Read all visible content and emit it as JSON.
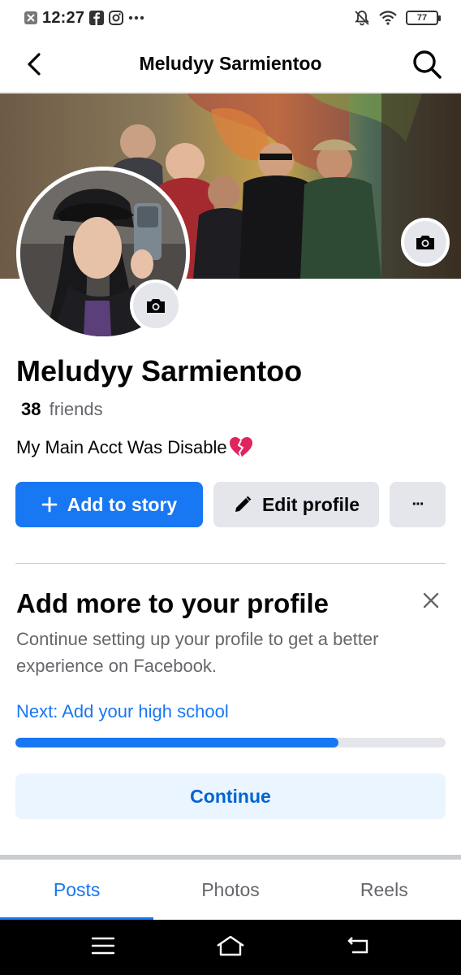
{
  "status_bar": {
    "time": "12:27",
    "battery": "77",
    "left_icons": [
      "app-icon",
      "facebook-icon",
      "instagram-icon",
      "more-dots-icon"
    ],
    "right_icons": [
      "bell-muted-icon",
      "wifi-icon",
      "battery-icon"
    ]
  },
  "header": {
    "title": "Meludyy Sarmientoo",
    "back_icon": "chevron-left-icon",
    "search_icon": "search-icon"
  },
  "profile": {
    "name": "Meludyy Sarmientoo",
    "friends_count": "38",
    "friends_label": "friends",
    "bio": "My Main Acct Was Disable",
    "bio_emoji": "💔"
  },
  "actions": {
    "add_story": "Add to story",
    "edit_profile": "Edit profile",
    "more": "···"
  },
  "card": {
    "title": "Add more to your profile",
    "description": "Continue setting up your profile to get a better experience on Facebook.",
    "next": "Next: Add your high school",
    "progress": 0.75,
    "continue": "Continue"
  },
  "tabs": [
    {
      "label": "Posts",
      "active": true
    },
    {
      "label": "Photos",
      "active": false
    },
    {
      "label": "Reels",
      "active": false
    }
  ],
  "colors": {
    "primary": "#1877f2",
    "button_grey": "#e4e6eb",
    "text_secondary": "#65676b",
    "continue_bg": "#ebf5ff"
  }
}
